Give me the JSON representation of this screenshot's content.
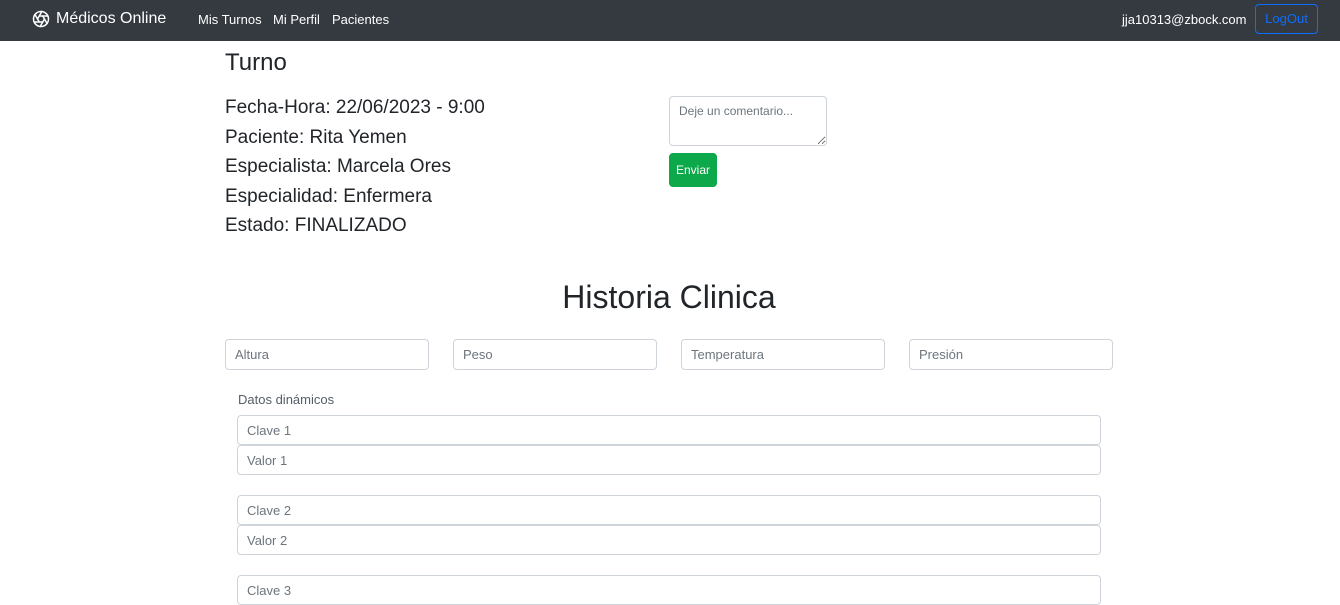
{
  "navbar": {
    "brand": "Médicos Online",
    "brand_icon": "aperture-icon",
    "links": [
      "Mis Turnos",
      "Mi Perfil",
      "Pacientes"
    ],
    "user_email": "jja10313@zbock.com",
    "logout_label": "LogOut"
  },
  "turno": {
    "title": "Turno",
    "fecha_hora": "Fecha-Hora: 22/06/2023 - 9:00",
    "paciente": "Paciente: Rita Yemen",
    "especialista": "Especialista: Marcela Ores",
    "especialidad": "Especialidad: Enfermera",
    "estado": "Estado: FINALIZADO",
    "comment_placeholder": "Deje un comentario...",
    "send_label": "Enviar"
  },
  "historia": {
    "title": "Historia Clinica",
    "fields": {
      "altura": "Altura",
      "peso": "Peso",
      "temperatura": "Temperatura",
      "presion": "Presión"
    },
    "dynamic_label": "Datos dinámicos",
    "dynamic": [
      {
        "clave": "Clave 1",
        "valor": "Valor 1"
      },
      {
        "clave": "Clave 2",
        "valor": "Valor 2"
      },
      {
        "clave": "Clave 3"
      }
    ]
  },
  "colors": {
    "navbar_bg": "#343a40",
    "accent_blue": "#0d6efd",
    "success_green": "#0ca84a"
  }
}
